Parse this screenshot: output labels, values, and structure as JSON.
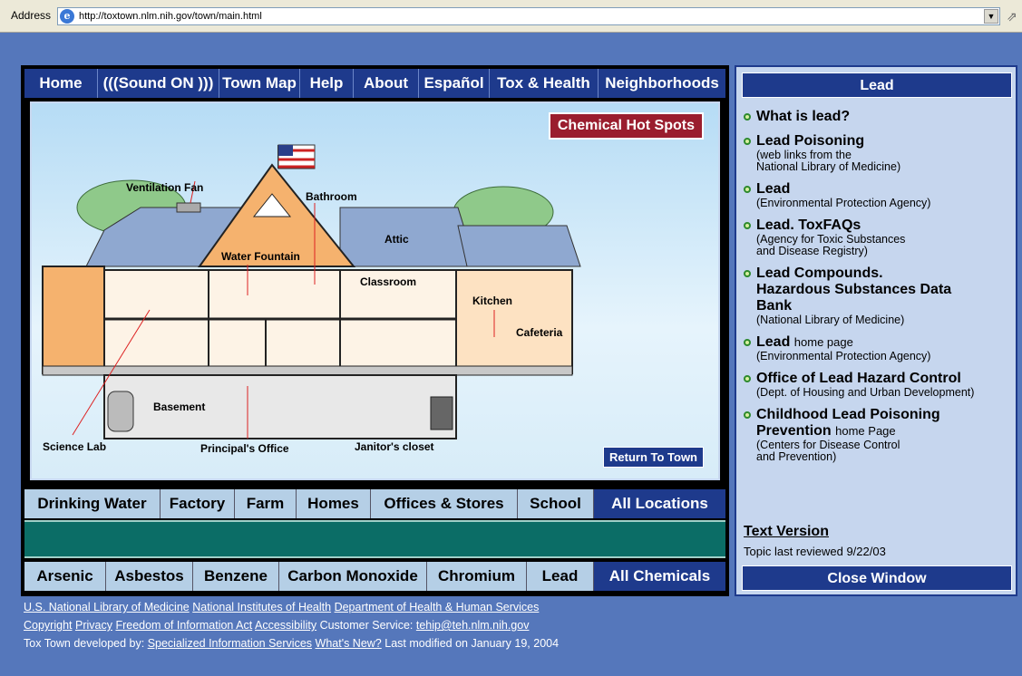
{
  "browser": {
    "address_label": "Address",
    "url": "http://toxtown.nlm.nih.gov/town/main.html"
  },
  "top_nav": [
    {
      "label": "Home"
    },
    {
      "label": "(((Sound ON )))"
    },
    {
      "label": "Town Map"
    },
    {
      "label": "Help"
    },
    {
      "label": "About"
    },
    {
      "label": "Español"
    },
    {
      "label": "Tox & Health"
    },
    {
      "label": "Neighborhoods"
    }
  ],
  "scene": {
    "hot_spots_button": "Chemical Hot Spots",
    "return_button": "Return To Town",
    "labels": {
      "ventilation_fan": "Ventilation Fan",
      "bathroom": "Bathroom",
      "attic": "Attic",
      "water_fountain": "Water Fountain",
      "classroom": "Classroom",
      "kitchen": "Kitchen",
      "cafeteria": "Cafeteria",
      "basement": "Basement",
      "science_lab": "Science Lab",
      "principals_office": "Principal's Office",
      "janitors_closet": "Janitor's closet"
    }
  },
  "locations_nav": [
    {
      "label": "Drinking Water"
    },
    {
      "label": "Factory"
    },
    {
      "label": "Farm"
    },
    {
      "label": "Homes"
    },
    {
      "label": "Offices & Stores"
    },
    {
      "label": "School"
    },
    {
      "label": "All Locations"
    }
  ],
  "chemicals_nav": [
    {
      "label": "Arsenic"
    },
    {
      "label": "Asbestos"
    },
    {
      "label": "Benzene"
    },
    {
      "label": "Carbon Monoxide"
    },
    {
      "label": "Chromium"
    },
    {
      "label": "Lead"
    },
    {
      "label": "All Chemicals"
    }
  ],
  "side_panel": {
    "title": "Lead",
    "items": [
      {
        "title": "What is lead?",
        "inline": "",
        "desc": []
      },
      {
        "title": "Lead Poisoning",
        "inline": "",
        "desc": [
          "(web links from the",
          "National Library of Medicine)"
        ]
      },
      {
        "title": "Lead",
        "inline": "",
        "desc": [
          "(Environmental Protection Agency)"
        ]
      },
      {
        "title": "Lead. ToxFAQs",
        "inline": "",
        "desc": [
          "(Agency for Toxic Substances",
          "and Disease Registry)"
        ]
      },
      {
        "title": "Lead Compounds. Hazardous Substances Data Bank",
        "inline": "",
        "desc": [
          "(National Library of Medicine)"
        ]
      },
      {
        "title": "Lead",
        "inline": "home page",
        "desc": [
          "(Environmental Protection Agency)"
        ]
      },
      {
        "title": "Office of Lead Hazard Control",
        "inline": "",
        "desc": [
          "(Dept. of Housing and Urban Development)"
        ]
      },
      {
        "title": "Childhood Lead Poisoning Prevention",
        "inline": "home Page",
        "desc": [
          "(Centers for Disease Control",
          "and Prevention)"
        ]
      }
    ],
    "text_version": "Text Version",
    "reviewed": "Topic last reviewed 9/22/03",
    "close_button": "Close Window"
  },
  "footer": {
    "line1": [
      "U.S. National Library of Medicine",
      "National Institutes of Health",
      "Department of Health & Human Services"
    ],
    "line2_links": [
      "Copyright",
      "Privacy",
      "Freedom of Information Act",
      "Accessibility"
    ],
    "customer_service_label": "Customer Service:",
    "customer_service_email": "tehip@teh.nlm.nih.gov",
    "developed_by_label": "Tox Town developed by:",
    "developed_by_links": [
      "Specialized Information Services",
      "What's New?"
    ],
    "last_modified": "Last modified on January 19, 2004"
  },
  "colors": {
    "page_bg": "#5577bb",
    "nav_blue": "#1e3a8c",
    "hot_spots_red": "#9a1d2e",
    "teal": "#0b6d66",
    "bullet_green": "#2e8a2e"
  }
}
